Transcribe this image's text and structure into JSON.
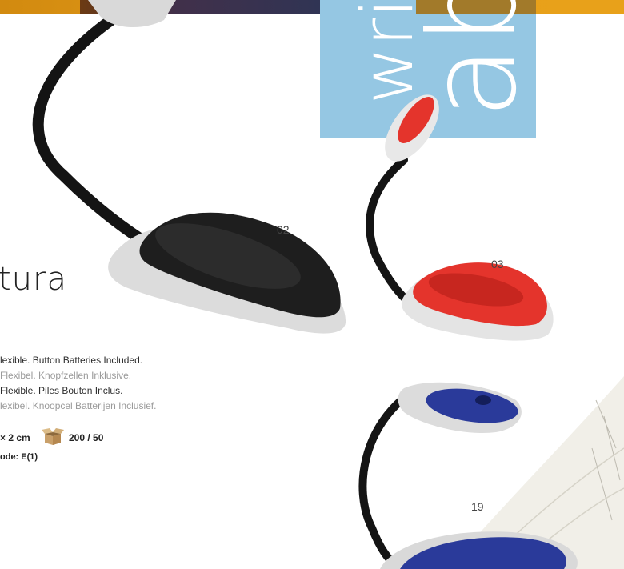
{
  "decor": {
    "vertical_word": "wri",
    "vertical_letters": "ab"
  },
  "title": "tura",
  "description": [
    "lexible. Button Batteries Included.",
    "Flexibel. Knopfzellen Inklusive.",
    "Flexible. Piles Bouton Inclus.",
    "lexibel. Knoopcel Batterijen Inclusief."
  ],
  "size_text": "× 2 cm",
  "carton_qty": "200 / 50",
  "code_text": "ode: E(1)",
  "variant_numbers": [
    "02",
    "03",
    "19"
  ],
  "colors": {
    "banner": "#e7a018",
    "panel": "#95c7e3",
    "black_variant": "#1e1e1e",
    "red_variant": "#e4342c",
    "blue_variant": "#2a3a9a"
  },
  "icons": {
    "carton": "open-box-icon"
  }
}
